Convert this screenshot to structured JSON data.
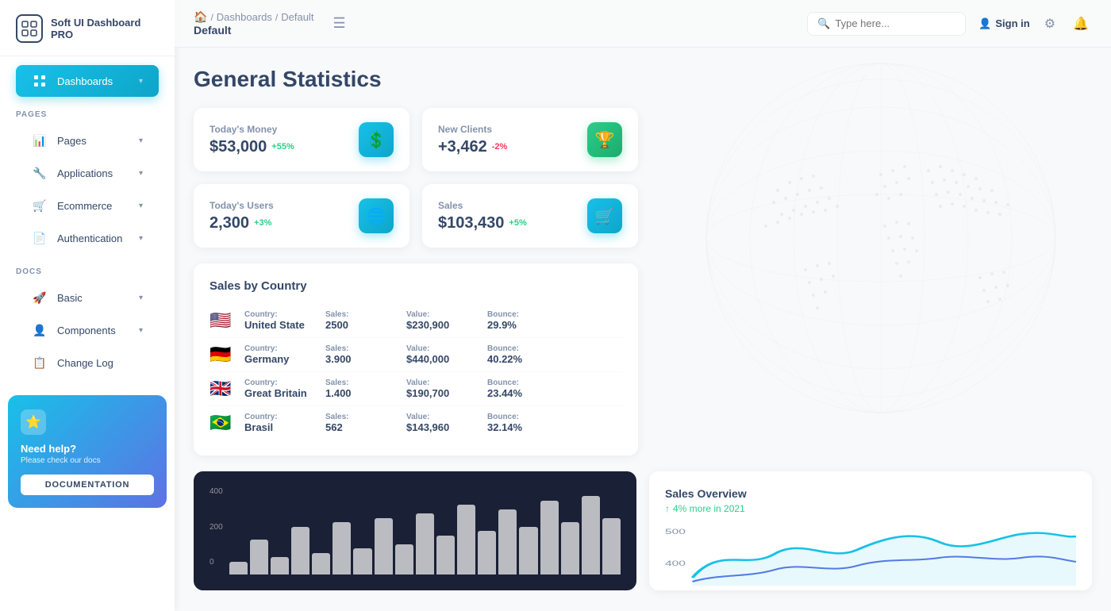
{
  "app": {
    "logo_text": "Soft UI Dashboard PRO",
    "logo_icon": "⊞"
  },
  "sidebar": {
    "pages_label": "PAGES",
    "docs_label": "DOCS",
    "items_pages": [
      {
        "id": "dashboards",
        "label": "Dashboards",
        "icon": "⊞",
        "active": true,
        "has_chevron": true
      },
      {
        "id": "pages",
        "label": "Pages",
        "icon": "📊",
        "active": false,
        "has_chevron": true
      },
      {
        "id": "applications",
        "label": "Applications",
        "icon": "🔧",
        "active": false,
        "has_chevron": true
      },
      {
        "id": "ecommerce",
        "label": "Ecommerce",
        "icon": "🛒",
        "active": false,
        "has_chevron": true
      },
      {
        "id": "authentication",
        "label": "Authentication",
        "icon": "📄",
        "active": false,
        "has_chevron": true
      }
    ],
    "items_docs": [
      {
        "id": "basic",
        "label": "Basic",
        "icon": "🚀",
        "active": false,
        "has_chevron": true
      },
      {
        "id": "components",
        "label": "Components",
        "icon": "👤",
        "active": false,
        "has_chevron": true
      },
      {
        "id": "changelog",
        "label": "Change Log",
        "icon": "📋",
        "active": false,
        "has_chevron": false
      }
    ],
    "help": {
      "star_icon": "⭐",
      "title": "Need help?",
      "subtitle": "Please check our docs",
      "button_label": "DOCUMENTATION"
    }
  },
  "topbar": {
    "breadcrumb_home_icon": "🏠",
    "breadcrumb_sep1": "/",
    "breadcrumb_link": "Dashboards",
    "breadcrumb_sep2": "/",
    "breadcrumb_current": "Default",
    "page_title_top": "Default",
    "hamburger_icon": "☰",
    "search_placeholder": "Type here...",
    "signin_label": "Sign in",
    "settings_icon": "⚙",
    "notification_icon": "🔔"
  },
  "main": {
    "title": "General Statistics"
  },
  "stats": [
    {
      "id": "todays-money",
      "label": "Today's Money",
      "value": "$53,000",
      "badge": "+55%",
      "badge_type": "positive",
      "icon": "💲",
      "icon_style": "blue"
    },
    {
      "id": "new-clients",
      "label": "New Clients",
      "value": "+3,462",
      "badge": "-2%",
      "badge_type": "negative",
      "icon": "🏆",
      "icon_style": "green"
    },
    {
      "id": "todays-users",
      "label": "Today's Users",
      "value": "2,300",
      "badge": "+3%",
      "badge_type": "positive",
      "icon": "🌐",
      "icon_style": "blue"
    },
    {
      "id": "sales",
      "label": "Sales",
      "value": "$103,430",
      "badge": "+5%",
      "badge_type": "positive",
      "icon": "🛒",
      "icon_style": "cart"
    }
  ],
  "sales_by_country": {
    "title": "Sales by Country",
    "columns": [
      "Country:",
      "Sales:",
      "Value:",
      "Bounce:"
    ],
    "rows": [
      {
        "flag": "🇺🇸",
        "country": "United State",
        "sales": "2500",
        "value": "$230,900",
        "bounce": "29.9%"
      },
      {
        "flag": "🇩🇪",
        "country": "Germany",
        "sales": "3.900",
        "value": "$440,000",
        "bounce": "40.22%"
      },
      {
        "flag": "🇬🇧",
        "country": "Great Britain",
        "sales": "1.400",
        "value": "$190,700",
        "bounce": "23.44%"
      },
      {
        "flag": "🇧🇷",
        "country": "Brasil",
        "sales": "562",
        "value": "$143,960",
        "bounce": "32.14%"
      }
    ]
  },
  "sales_overview": {
    "title": "Sales Overview",
    "subtitle": "4% more in 2021",
    "up_icon": "↑",
    "y_labels_light": [
      "500",
      "400"
    ]
  },
  "bar_chart": {
    "y_labels": [
      "400",
      "200",
      "0"
    ],
    "bars": [
      15,
      40,
      20,
      55,
      25,
      60,
      30,
      65,
      35,
      70,
      45,
      80,
      50,
      75,
      55,
      85,
      60,
      90,
      65
    ]
  }
}
